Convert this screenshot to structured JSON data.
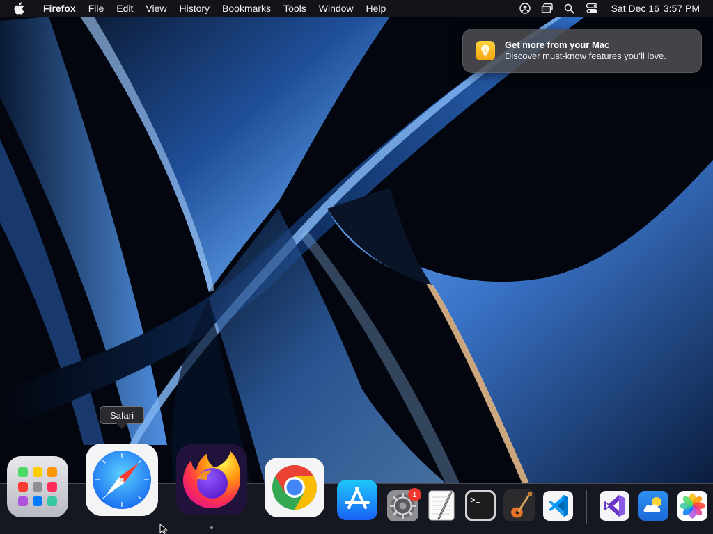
{
  "menubar": {
    "apple_icon": "apple-logo",
    "menus": [
      "Firefox",
      "File",
      "Edit",
      "View",
      "History",
      "Bookmarks",
      "Tools",
      "Window",
      "Help"
    ],
    "status_icons": [
      "user-account-icon",
      "screen-mirroring-icon",
      "search-icon",
      "control-center-icon"
    ],
    "date": "Sat Dec 16",
    "time": "3:57 PM"
  },
  "notification": {
    "icon": "lightbulb-icon",
    "title": "Get more from your Mac",
    "body": "Discover must-know features you’ll love."
  },
  "dock": {
    "tooltip": "Safari",
    "items": [
      {
        "name": "Launchpad",
        "icon": "launchpad-icon"
      },
      {
        "name": "Safari",
        "icon": "safari-icon"
      },
      {
        "name": "Firefox",
        "icon": "firefox-icon",
        "running": true
      },
      {
        "name": "Google Chrome",
        "icon": "chrome-icon"
      },
      {
        "name": "App Store",
        "icon": "app-store-icon"
      },
      {
        "name": "System Settings",
        "icon": "system-settings-icon",
        "badge": "1"
      },
      {
        "name": "TextEdit",
        "icon": "textedit-icon"
      },
      {
        "name": "Terminal",
        "icon": "terminal-icon"
      },
      {
        "name": "GarageBand",
        "icon": "garageband-icon"
      },
      {
        "name": "Visual Studio Code",
        "icon": "vscode-icon"
      },
      {
        "name": "Visual Studio",
        "icon": "visual-studio-icon"
      },
      {
        "name": "Weather",
        "icon": "weather-icon"
      },
      {
        "name": "Photos",
        "icon": "photos-icon"
      }
    ]
  },
  "colors": {
    "menubar_bg": "#14161a",
    "notification_bg": "#4e4e52",
    "badge_red": "#f2382e",
    "wallpaper_blue": "#3f7fd8"
  }
}
